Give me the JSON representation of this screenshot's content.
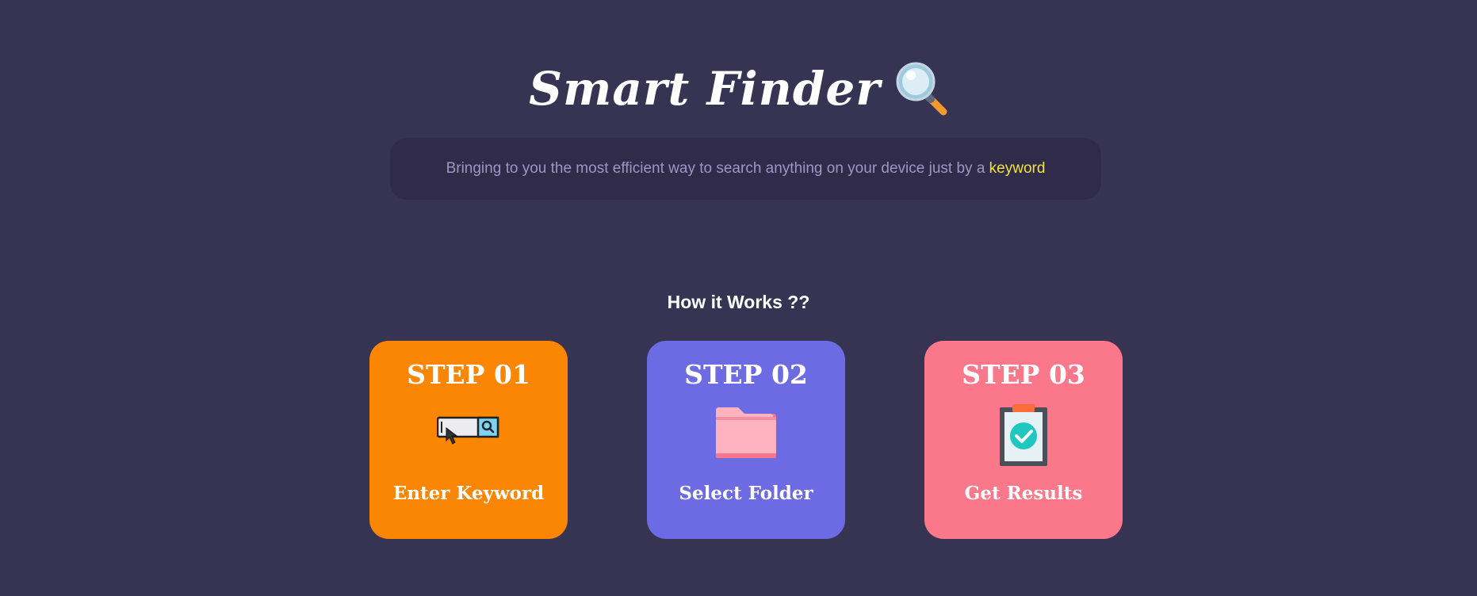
{
  "header": {
    "title": "Smart Finder",
    "title_icon": "magnifying-glass-icon",
    "subtitle_text": "Bringing to you the most efficient way to search anything on your device just by a ",
    "subtitle_highlight": "keyword"
  },
  "how_it_works": {
    "heading": "How it Works ??",
    "steps": [
      {
        "title": "STEP 01",
        "label": "Enter Keyword",
        "icon": "search-bar-icon",
        "color": "#fb8603"
      },
      {
        "title": "STEP 02",
        "label": "Select Folder",
        "icon": "folder-icon",
        "color": "#6c6be3"
      },
      {
        "title": "STEP 03",
        "label": "Get Results",
        "icon": "clipboard-check-icon",
        "color": "#fb788a"
      }
    ]
  },
  "colors": {
    "background": "#373353",
    "subtitle_box": "#2f2b48",
    "subtitle_text": "#9d97c4",
    "highlight": "#f4e23a"
  }
}
